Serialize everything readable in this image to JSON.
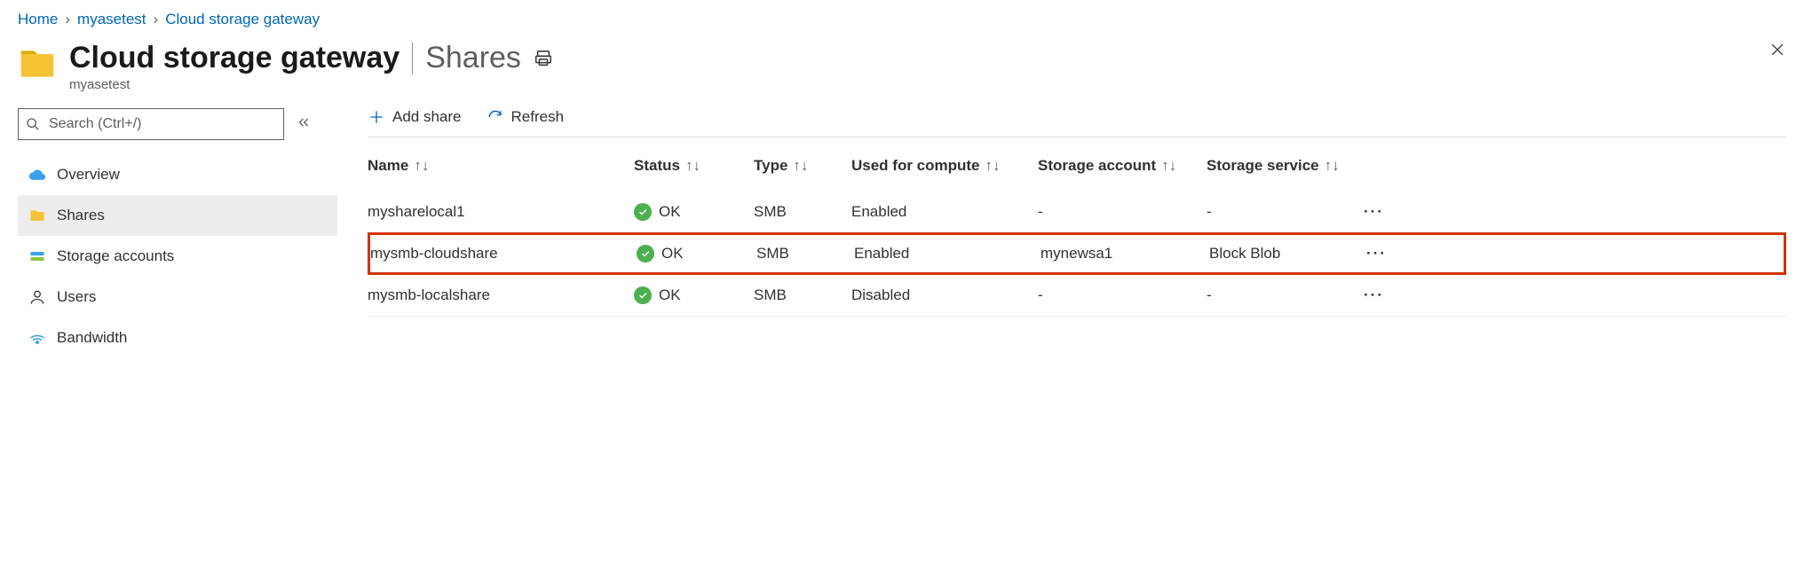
{
  "breadcrumb": {
    "home": "Home",
    "resource": "myasetest",
    "blade": "Cloud storage gateway"
  },
  "header": {
    "title": "Cloud storage gateway",
    "section": "Shares",
    "subtitle": "myasetest"
  },
  "search": {
    "placeholder": "Search (Ctrl+/)"
  },
  "sidebar": {
    "items": [
      {
        "label": "Overview"
      },
      {
        "label": "Shares"
      },
      {
        "label": "Storage accounts"
      },
      {
        "label": "Users"
      },
      {
        "label": "Bandwidth"
      }
    ]
  },
  "toolbar": {
    "add_label": "Add share",
    "refresh_label": "Refresh"
  },
  "columns": {
    "name": "Name",
    "status": "Status",
    "type": "Type",
    "compute": "Used for compute",
    "account": "Storage account",
    "service": "Storage service"
  },
  "rows": [
    {
      "name": "mysharelocal1",
      "status": "OK",
      "type": "SMB",
      "compute": "Enabled",
      "account": "-",
      "service": "-",
      "highlight": false
    },
    {
      "name": "mysmb-cloudshare",
      "status": "OK",
      "type": "SMB",
      "compute": "Enabled",
      "account": "mynewsa1",
      "service": "Block Blob",
      "highlight": true
    },
    {
      "name": "mysmb-localshare",
      "status": "OK",
      "type": "SMB",
      "compute": "Disabled",
      "account": "-",
      "service": "-",
      "highlight": false
    }
  ]
}
